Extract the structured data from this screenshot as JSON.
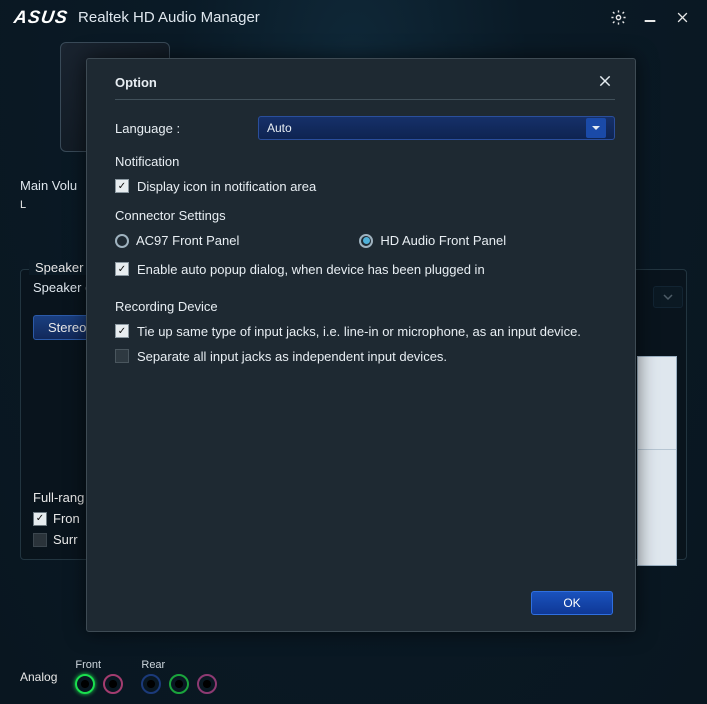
{
  "titlebar": {
    "logo": "ASUS",
    "title": "Realtek HD Audio Manager"
  },
  "main": {
    "volume_label": "Main Volu",
    "lr_label": "L",
    "panel_title": "Speaker Co",
    "speaker_label": "Speaker (",
    "stereo_btn": "Stereo",
    "fullrange_label": "Full-rang",
    "front_cb": "Fron",
    "surr_cb": "Surr"
  },
  "footer": {
    "analog": "Analog",
    "front": "Front",
    "rear": "Rear"
  },
  "modal": {
    "title": "Option",
    "language_label": "Language :",
    "language_value": "Auto",
    "notification_section": "Notification",
    "notify_cb": "Display icon in notification area",
    "connector_section": "Connector Settings",
    "radio_ac97": "AC97 Front Panel",
    "radio_hd": "HD Audio Front Panel",
    "auto_popup": "Enable auto popup dialog, when device has been plugged in",
    "recording_section": "Recording Device",
    "tieup": "Tie up same type of input jacks, i.e. line-in or microphone, as an input device.",
    "separate": "Separate all input jacks as independent input devices.",
    "ok": "OK"
  }
}
